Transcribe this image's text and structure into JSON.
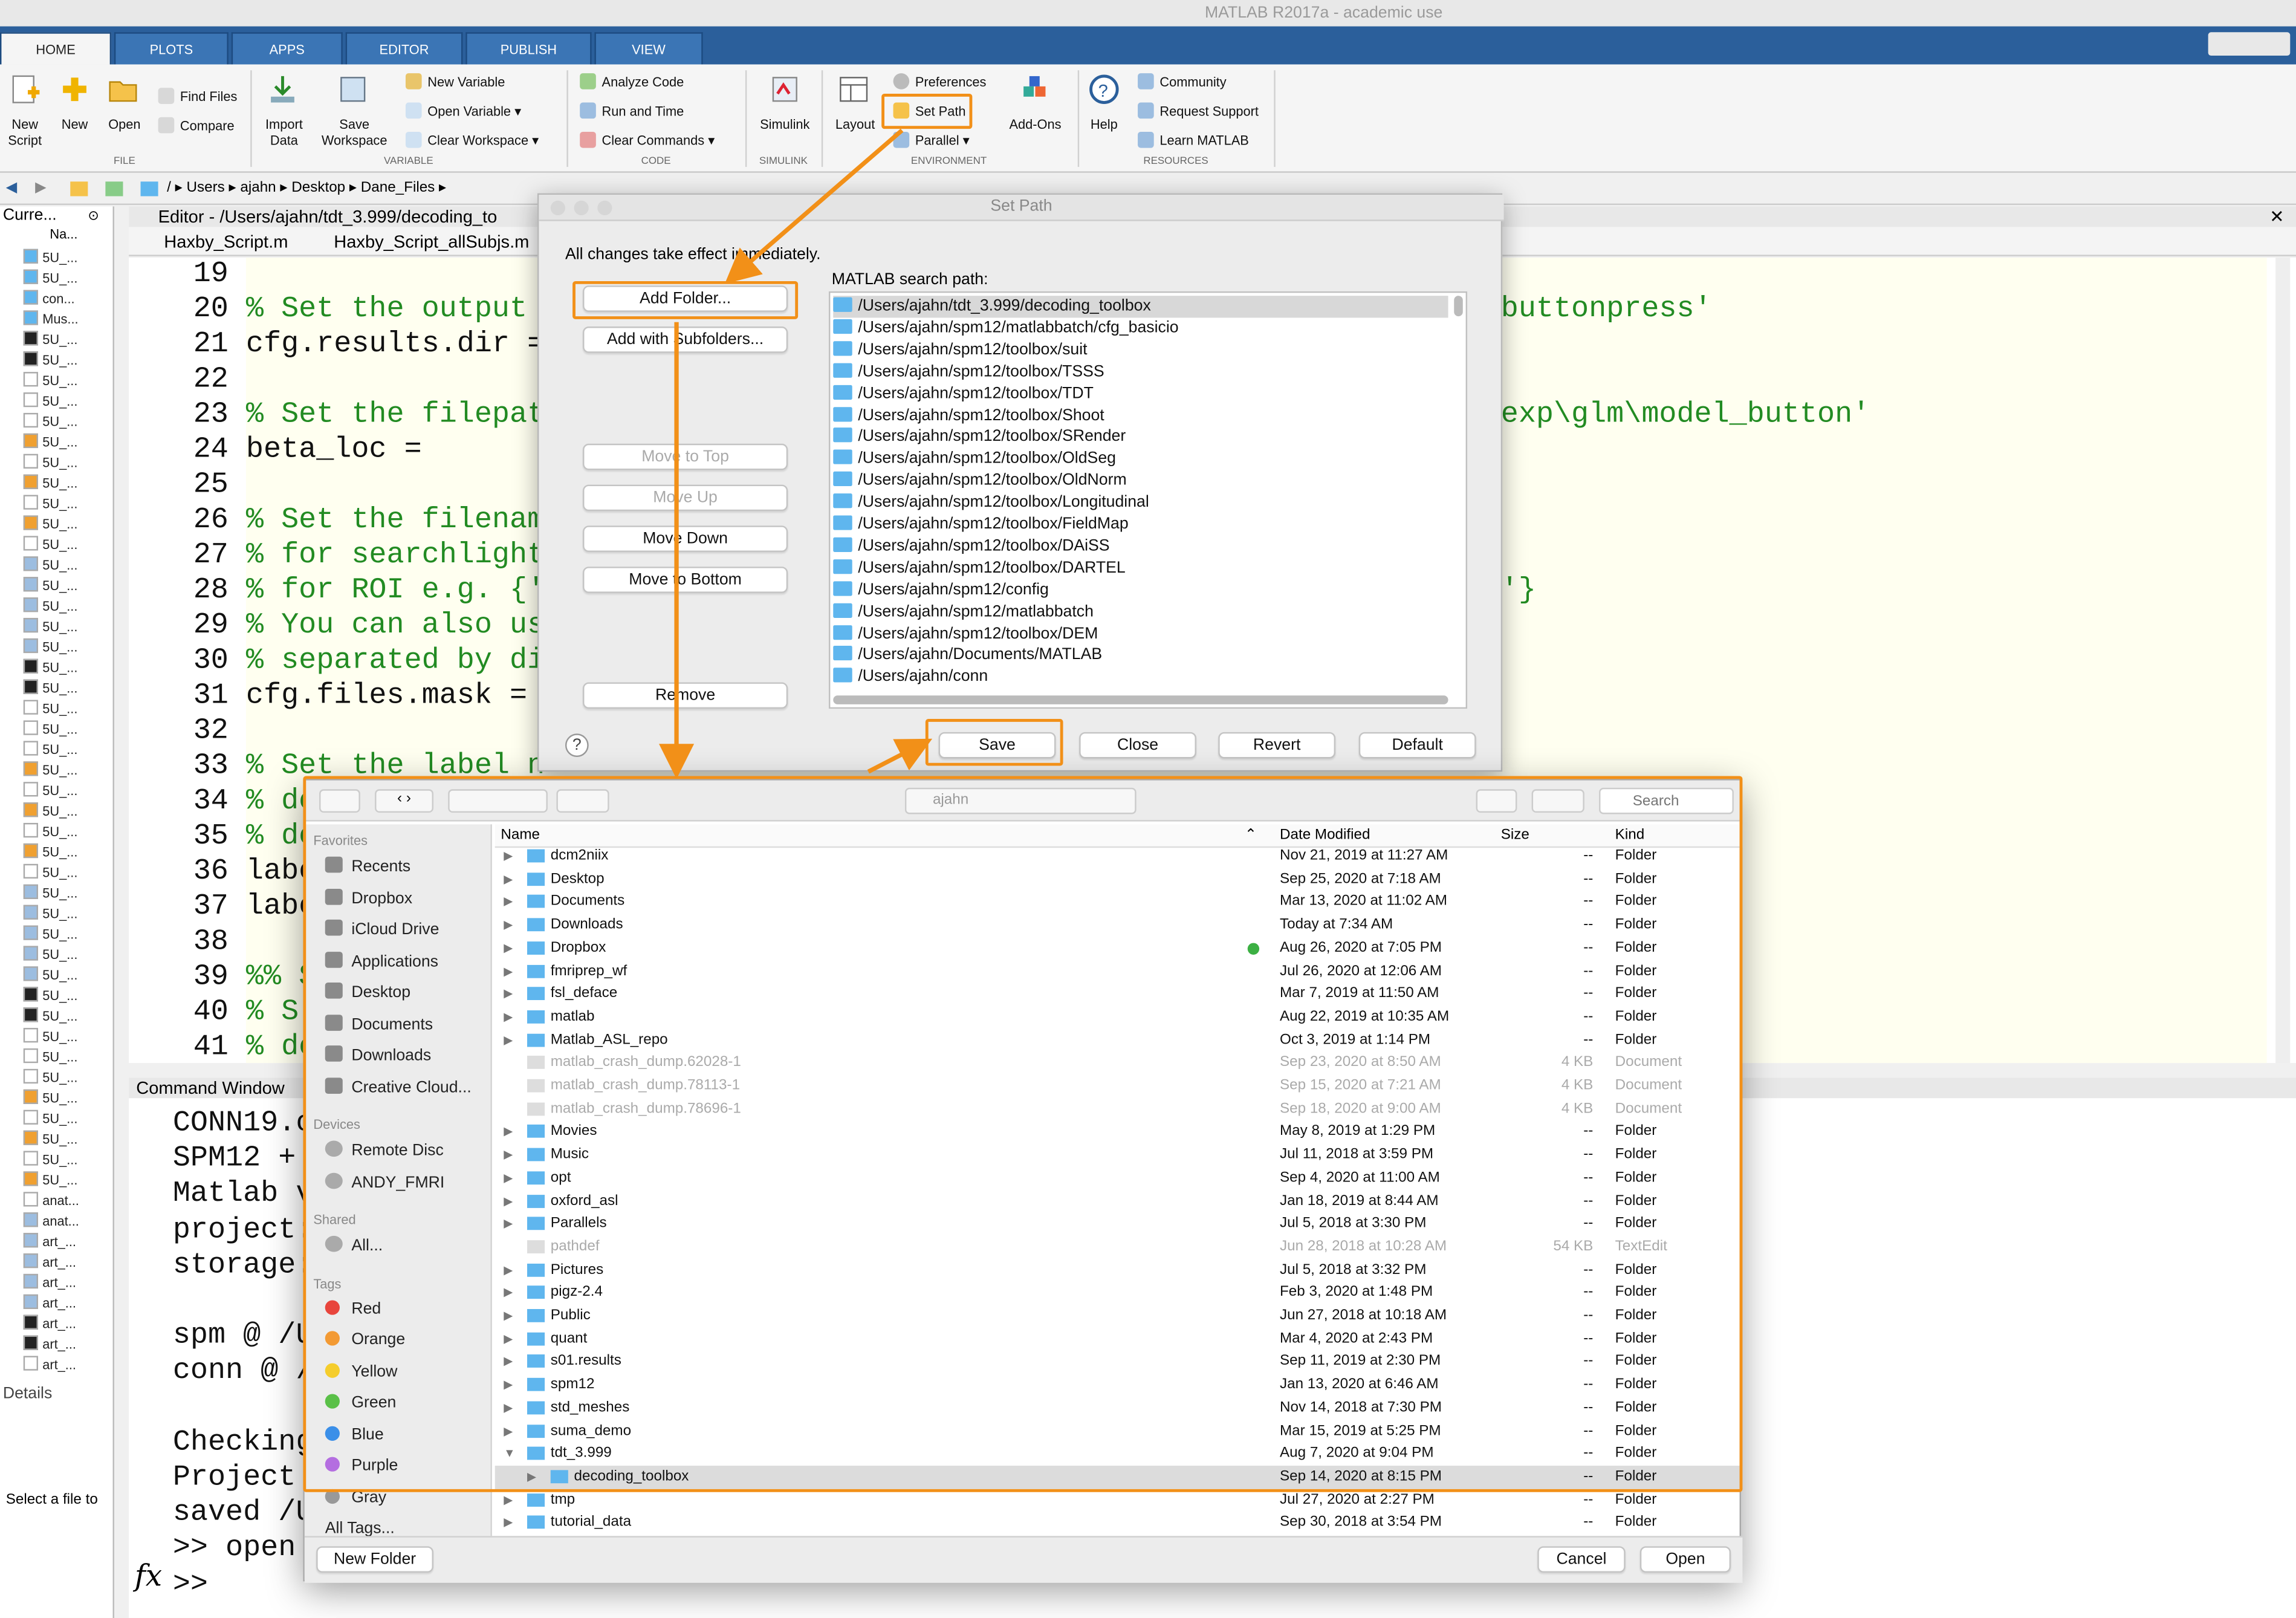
{
  "window": {
    "title": "MATLAB R2017a - academic use"
  },
  "tabs": [
    "HOME",
    "PLOTS",
    "APPS",
    "EDITOR",
    "PUBLISH",
    "VIEW"
  ],
  "ribbon": {
    "file": {
      "new_script": "New\nScript",
      "new": "New",
      "open": "Open",
      "find_files": "Find Files",
      "compare": "Compare",
      "label": "FILE"
    },
    "variable": {
      "import_data": "Import\nData",
      "save_workspace": "Save\nWorkspace",
      "new_variable": "New Variable",
      "open_variable": "Open Variable",
      "clear_workspace": "Clear Workspace",
      "label": "VARIABLE"
    },
    "code": {
      "analyze_code": "Analyze Code",
      "run_and_time": "Run and Time",
      "clear_commands": "Clear Commands",
      "label": "CODE"
    },
    "simulink": {
      "simulink": "Simulink",
      "label": "SIMULINK"
    },
    "environment": {
      "layout": "Layout",
      "preferences": "Preferences",
      "set_path": "Set Path",
      "parallel": "Parallel",
      "add_ons": "Add-Ons",
      "label": "ENVIRONMENT"
    },
    "resources": {
      "help": "Help",
      "community": "Community",
      "request_support": "Request Support",
      "learn_matlab": "Learn MATLAB",
      "label": "RESOURCES"
    }
  },
  "address": [
    "/",
    "Users",
    "ajahn",
    "Desktop",
    "Dane_Files"
  ],
  "current_folder": {
    "title": "Curre...",
    "col_name": "Na...",
    "items": [
      "5U_...",
      "5U_...",
      "con...",
      "Mus...",
      "5U_...",
      "5U_...",
      "5U_...",
      "5U_...",
      "5U_...",
      "5U_...",
      "5U_...",
      "5U_...",
      "5U_...",
      "5U_...",
      "5U_...",
      "5U_...",
      "5U_...",
      "5U_...",
      "5U_...",
      "5U_...",
      "5U_...",
      "5U_...",
      "5U_...",
      "5U_...",
      "5U_...",
      "5U_...",
      "5U_...",
      "5U_...",
      "5U_...",
      "5U_...",
      "5U_...",
      "5U_...",
      "5U_...",
      "5U_...",
      "5U_...",
      "5U_...",
      "5U_...",
      "5U_...",
      "5U_...",
      "5U_...",
      "5U_...",
      "5U_...",
      "5U_...",
      "5U_...",
      "5U_...",
      "5U_...",
      "anat...",
      "anat...",
      "art_...",
      "art_...",
      "art_...",
      "art_...",
      "art_...",
      "art_...",
      "art_..."
    ],
    "details_label": "Details",
    "select_file": "Select a file to"
  },
  "editor": {
    "title": "Editor - /Users/ajahn/tdt_3.999/decoding_to",
    "tabs": [
      "Haxby_Script.m",
      "Haxby_Script_allSubjs.m"
    ],
    "line_numbers": [
      "19",
      "20",
      "21",
      "22",
      "23",
      "24",
      "25",
      "26",
      "27",
      "28",
      "29",
      "30",
      "31",
      "32",
      "33",
      "34",
      "35",
      "36",
      "37",
      "38",
      "39",
      "40",
      "41"
    ],
    "lines": [
      "",
      "% Set the output",
      "cfg.results.dir =",
      "",
      "% Set the filepat",
      "beta_loc =",
      "",
      "% Set the filenam",
      "% for searchlight",
      "% for ROI e.g. {'",
      "% You can also use",
      "% separated by di",
      "cfg.files.mask =",
      "",
      "% Set the label n",
      "% do",
      "% do",
      "labe",
      "labe",
      "",
      "%% S",
      "% S",
      "% do"
    ],
    "right_fragments": {
      "line20": "buttonpress'",
      "line23": "exp\\glm\\model_button'",
      "line28": "'}"
    }
  },
  "command_window": {
    "title": "Command Window",
    "lines": [
      "CONN19.c",
      "SPM12 + ",
      "Matlab v",
      "project:",
      "storage:",
      "",
      "spm @ /U",
      "conn @ /",
      "",
      "Checking",
      "Project ",
      "saved /U",
      ">> open ",
      ">>"
    ],
    "prompt_icon": "fx"
  },
  "set_path": {
    "title": "Set Path",
    "note": "All changes take effect immediately.",
    "search_path_label": "MATLAB search path:",
    "buttons": {
      "add_folder": "Add Folder...",
      "add_with_subfolders": "Add with Subfolders...",
      "move_top": "Move to Top",
      "move_up": "Move Up",
      "move_down": "Move Down",
      "move_bottom": "Move to Bottom",
      "remove": "Remove",
      "save": "Save",
      "close": "Close",
      "revert": "Revert",
      "default": "Default"
    },
    "paths": [
      "/Users/ajahn/tdt_3.999/decoding_toolbox",
      "/Users/ajahn/spm12/matlabbatch/cfg_basicio",
      "/Users/ajahn/spm12/toolbox/suit",
      "/Users/ajahn/spm12/toolbox/TSSS",
      "/Users/ajahn/spm12/toolbox/TDT",
      "/Users/ajahn/spm12/toolbox/Shoot",
      "/Users/ajahn/spm12/toolbox/SRender",
      "/Users/ajahn/spm12/toolbox/OldSeg",
      "/Users/ajahn/spm12/toolbox/OldNorm",
      "/Users/ajahn/spm12/toolbox/Longitudinal",
      "/Users/ajahn/spm12/toolbox/FieldMap",
      "/Users/ajahn/spm12/toolbox/DAiSS",
      "/Users/ajahn/spm12/toolbox/DARTEL",
      "/Users/ajahn/spm12/config",
      "/Users/ajahn/spm12/matlabbatch",
      "/Users/ajahn/spm12/toolbox/DEM",
      "/Users/ajahn/Documents/MATLAB",
      "/Users/ajahn/conn"
    ]
  },
  "finder": {
    "location": "ajahn",
    "search_placeholder": "Search",
    "columns": {
      "name": "Name",
      "date": "Date Modified",
      "size": "Size",
      "kind": "Kind"
    },
    "favorites_label": "Favorites",
    "favorites": [
      "Recents",
      "Dropbox",
      "iCloud Drive",
      "Applications",
      "Desktop",
      "Documents",
      "Downloads",
      "Creative Cloud..."
    ],
    "devices_label": "Devices",
    "devices": [
      "Remote Disc",
      "ANDY_FMRI"
    ],
    "shared_label": "Shared",
    "shared": [
      "All..."
    ],
    "tags_label": "Tags",
    "tags": [
      {
        "name": "Red",
        "color": "#e8453c"
      },
      {
        "name": "Orange",
        "color": "#f39a33"
      },
      {
        "name": "Yellow",
        "color": "#f5cd2c"
      },
      {
        "name": "Green",
        "color": "#5ac048"
      },
      {
        "name": "Blue",
        "color": "#3b8fe8"
      },
      {
        "name": "Purple",
        "color": "#b46ee0"
      },
      {
        "name": "Gray",
        "color": "#999999"
      },
      {
        "name": "All Tags...",
        "color": ""
      }
    ],
    "files": [
      {
        "name": "dcm2niix",
        "date": "Nov 21, 2019 at 11:27 AM",
        "size": "--",
        "kind": "Folder",
        "dim": false
      },
      {
        "name": "Desktop",
        "date": "Sep 25, 2020 at 7:18 AM",
        "size": "--",
        "kind": "Folder",
        "dim": false
      },
      {
        "name": "Documents",
        "date": "Mar 13, 2020 at 11:02 AM",
        "size": "--",
        "kind": "Folder",
        "dim": false
      },
      {
        "name": "Downloads",
        "date": "Today at 7:34 AM",
        "size": "--",
        "kind": "Folder",
        "dim": false
      },
      {
        "name": "Dropbox",
        "date": "Aug 26, 2020 at 7:05 PM",
        "size": "--",
        "kind": "Folder",
        "dim": false
      },
      {
        "name": "fmriprep_wf",
        "date": "Jul 26, 2020 at 12:06 AM",
        "size": "--",
        "kind": "Folder",
        "dim": false
      },
      {
        "name": "fsl_deface",
        "date": "Mar 7, 2019 at 11:50 AM",
        "size": "--",
        "kind": "Folder",
        "dim": false
      },
      {
        "name": "matlab",
        "date": "Aug 22, 2019 at 10:35 AM",
        "size": "--",
        "kind": "Folder",
        "dim": false
      },
      {
        "name": "Matlab_ASL_repo",
        "date": "Oct 3, 2019 at 1:14 PM",
        "size": "--",
        "kind": "Folder",
        "dim": false
      },
      {
        "name": "matlab_crash_dump.62028-1",
        "date": "Sep 23, 2020 at 8:50 AM",
        "size": "4 KB",
        "kind": "Document",
        "dim": true
      },
      {
        "name": "matlab_crash_dump.78113-1",
        "date": "Sep 15, 2020 at 7:21 AM",
        "size": "4 KB",
        "kind": "Document",
        "dim": true
      },
      {
        "name": "matlab_crash_dump.78696-1",
        "date": "Sep 18, 2020 at 9:00 AM",
        "size": "4 KB",
        "kind": "Document",
        "dim": true
      },
      {
        "name": "Movies",
        "date": "May 8, 2019 at 1:29 PM",
        "size": "--",
        "kind": "Folder",
        "dim": false
      },
      {
        "name": "Music",
        "date": "Jul 11, 2018 at 3:59 PM",
        "size": "--",
        "kind": "Folder",
        "dim": false
      },
      {
        "name": "opt",
        "date": "Sep 4, 2020 at 11:00 AM",
        "size": "--",
        "kind": "Folder",
        "dim": false
      },
      {
        "name": "oxford_asl",
        "date": "Jan 18, 2019 at 8:44 AM",
        "size": "--",
        "kind": "Folder",
        "dim": false
      },
      {
        "name": "Parallels",
        "date": "Jul 5, 2018 at 3:30 PM",
        "size": "--",
        "kind": "Folder",
        "dim": false
      },
      {
        "name": "pathdef",
        "date": "Jun 28, 2018 at 10:28 AM",
        "size": "54 KB",
        "kind": "TextEdit",
        "dim": true
      },
      {
        "name": "Pictures",
        "date": "Jul 5, 2018 at 3:32 PM",
        "size": "--",
        "kind": "Folder",
        "dim": false
      },
      {
        "name": "pigz-2.4",
        "date": "Feb 3, 2020 at 1:48 PM",
        "size": "--",
        "kind": "Folder",
        "dim": false
      },
      {
        "name": "Public",
        "date": "Jun 27, 2018 at 10:18 AM",
        "size": "--",
        "kind": "Folder",
        "dim": false
      },
      {
        "name": "quant",
        "date": "Mar 4, 2020 at 2:43 PM",
        "size": "--",
        "kind": "Folder",
        "dim": false
      },
      {
        "name": "s01.results",
        "date": "Sep 11, 2019 at 2:30 PM",
        "size": "--",
        "kind": "Folder",
        "dim": false
      },
      {
        "name": "spm12",
        "date": "Jan 13, 2020 at 6:46 AM",
        "size": "--",
        "kind": "Folder",
        "dim": false
      },
      {
        "name": "std_meshes",
        "date": "Nov 14, 2018 at 7:30 PM",
        "size": "--",
        "kind": "Folder",
        "dim": false
      },
      {
        "name": "suma_demo",
        "date": "Mar 15, 2019 at 5:25 PM",
        "size": "--",
        "kind": "Folder",
        "dim": false
      },
      {
        "name": "tdt_3.999",
        "date": "Aug 7, 2020 at 9:04 PM",
        "size": "--",
        "kind": "Folder",
        "dim": false
      },
      {
        "name": "decoding_toolbox",
        "date": "Sep 14, 2020 at 8:15 PM",
        "size": "--",
        "kind": "Folder",
        "dim": false
      },
      {
        "name": "tmp",
        "date": "Jul 27, 2020 at 2:27 PM",
        "size": "--",
        "kind": "Folder",
        "dim": false
      },
      {
        "name": "tutorial_data",
        "date": "Sep 30, 2018 at 3:54 PM",
        "size": "--",
        "kind": "Folder",
        "dim": false
      }
    ],
    "new_folder": "New Folder",
    "cancel": "Cancel",
    "open": "Open"
  },
  "colors": {
    "accent": "#f29018",
    "ribbon_tab": "#2b5f9b",
    "comment": "#228b22",
    "string": "#a020f0",
    "folder": "#5fb6ee"
  }
}
